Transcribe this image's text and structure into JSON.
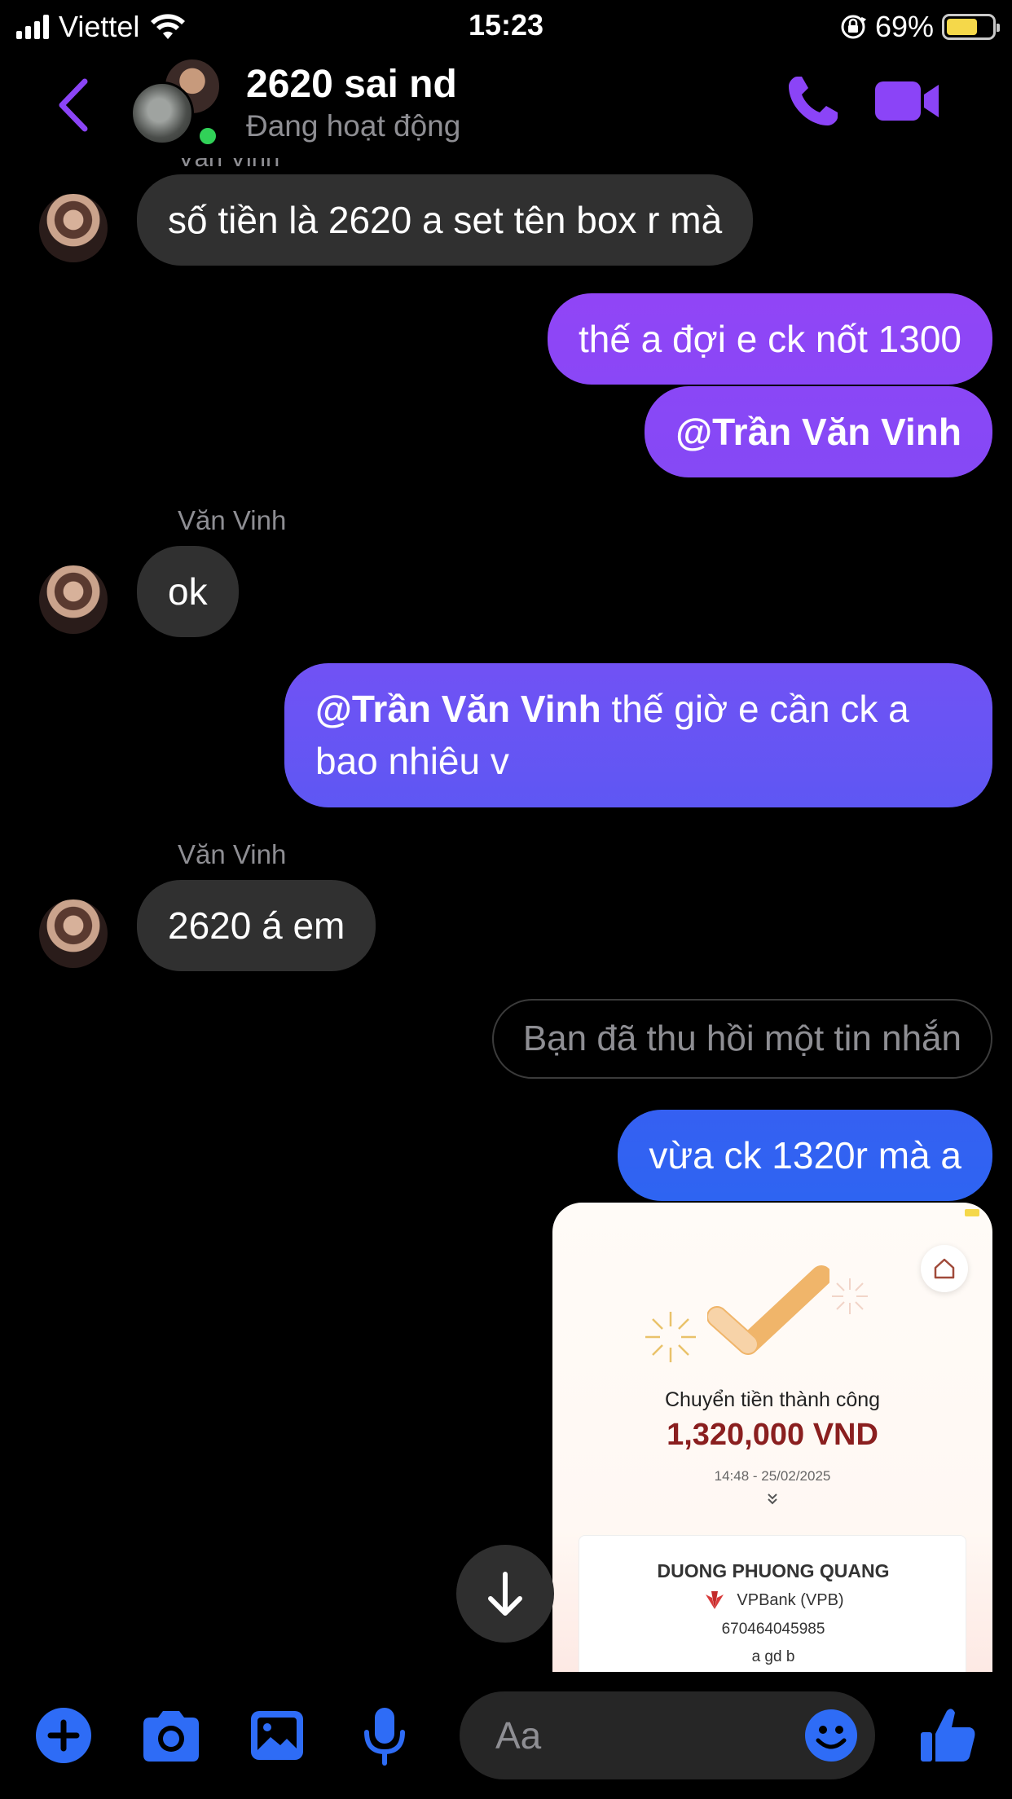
{
  "status_bar": {
    "carrier": "Viettel",
    "time": "15:23",
    "battery": "69%",
    "battery_level": 0.69
  },
  "header": {
    "title": "2620 sai nd",
    "subtitle": "Đang hoạt động"
  },
  "colors": {
    "accent_purple": "#8b44f7",
    "bubble_gradient_top": "#9145f6",
    "bubble_gradient_bottom": "#2e64f2",
    "incoming_bubble": "#303030",
    "online_green": "#31d158",
    "icon_blue": "#2e6cf6"
  },
  "messages": {
    "clipped_sender": "Văn Vinh",
    "m1": "số tiền là 2620 a set tên box r mà",
    "m2": "thế a đợi e ck nốt 1300",
    "m3": "@Trần Văn Vinh",
    "sender_1": "Văn Vinh",
    "m4": "ok",
    "m5_mention": "@Trần Văn Vinh",
    "m5_text": " thế giờ e cần ck a bao nhiêu v",
    "sender_2": "Văn Vinh",
    "m6": "2620 á em",
    "recalled": "Bạn đã thu hồi một tin nhắn",
    "m7": "vừa ck 1320r mà a"
  },
  "receipt": {
    "title": "Chuyển tiền thành công",
    "amount": "1,320,000 VND",
    "timestamp": "14:48 - 25/02/2025",
    "recipient": "DUONG PHUONG QUANG",
    "bank": "VPBank (VPB)",
    "account": "670464045985",
    "note": "a gd b"
  },
  "composer": {
    "placeholder": "Aa"
  },
  "icons": {
    "bottom": [
      "plus-icon",
      "camera-icon",
      "image-icon",
      "microphone-icon",
      "emoji-icon",
      "thumbs-up-icon"
    ],
    "header": [
      "back-arrow-icon",
      "phone-icon",
      "video-camera-icon"
    ]
  }
}
